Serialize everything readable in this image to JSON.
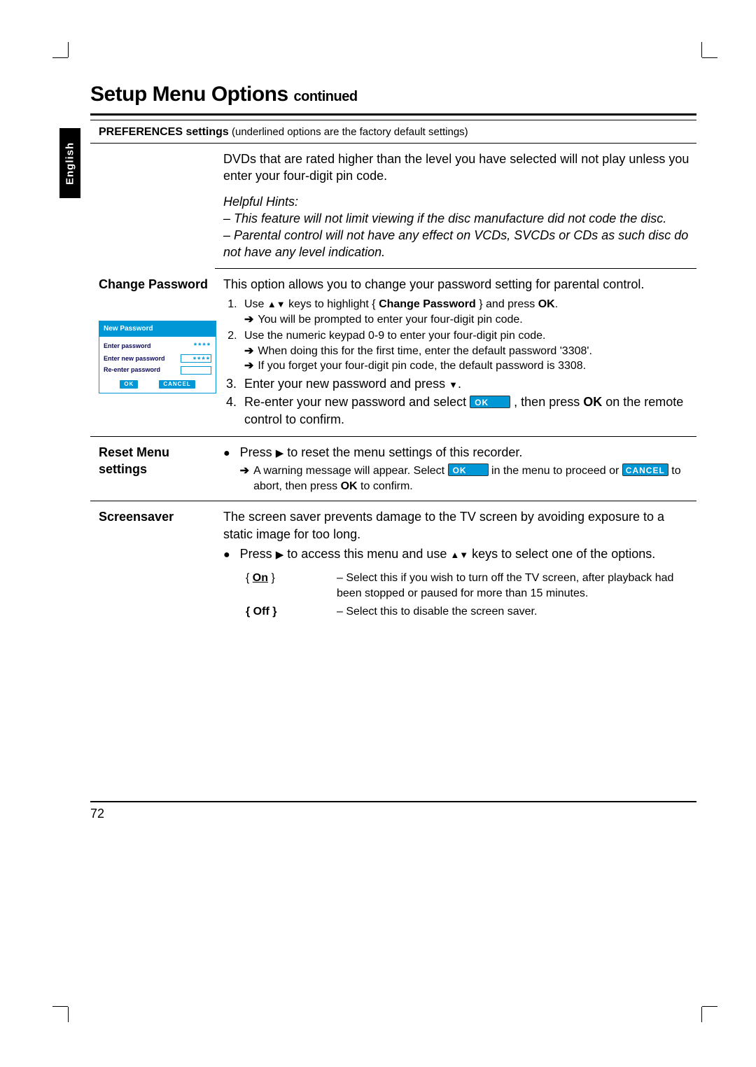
{
  "page": {
    "title_main": "Setup Menu Options",
    "title_cont": "continued",
    "language_tab": "English",
    "page_number": "72"
  },
  "preferences_header": {
    "bold": "PREFERENCES settings",
    "note": " (underlined options are the factory default settings)"
  },
  "rows": {
    "parental_cont": {
      "desc1": "DVDs that are rated higher than the level you have selected will not play unless you enter your four-digit pin code.",
      "hints_label": "Helpful Hints:",
      "hint1": "– This feature will not limit viewing if the disc manufacture did not code the disc.",
      "hint2": "– Parental control will not have any effect on VCDs, SVCDs or CDs as such disc do not have any level indication."
    },
    "change_password": {
      "label": "Change Password",
      "dialog": {
        "title": "New Password",
        "r1": "Enter password",
        "r2": "Enter new password",
        "r3": "Re-enter password",
        "ok": "OK",
        "cancel": "CANCEL"
      },
      "desc": "This option allows you to change your password setting for parental control.",
      "step1_a": "Use ",
      "step1_b": " keys to highlight { ",
      "step1_opt": "Change Password",
      "step1_c": " } and press ",
      "step1_ok": "OK",
      "step1_d": ".",
      "step1_sub": " You will be prompted to enter your four-digit pin code.",
      "step2": "Use the numeric keypad 0-9 to enter your four-digit pin code.",
      "step2_sub": " When doing this for the first time, enter the default password '3308'.",
      "step2_sub2": " If you forget your four-digit pin code, the default password is 3308.",
      "step3_a": "Enter your new password and press ",
      "step3_b": ".",
      "step4_a": "Re-enter your new password and select  ",
      "step4_btn": "OK",
      "step4_b": "  , then press ",
      "step4_ok": "OK",
      "step4_c": " on the remote control to confirm."
    },
    "reset_menu": {
      "label": "Reset Menu settings",
      "line1_a": "Press ",
      "line1_b": " to reset the menu settings of this recorder.",
      "sub_a": " A warning message will appear. Select ",
      "sub_btn_ok": "OK",
      "sub_b": " in the menu to proceed or  ",
      "sub_btn_cancel": "CANCEL",
      "sub_c": "  to abort, then press ",
      "sub_ok": "OK",
      "sub_d": " to confirm."
    },
    "screensaver": {
      "label": "Screensaver",
      "desc": "The screen saver prevents damage to the TV screen by avoiding exposure to a static image for too long.",
      "bullet_a": "Press ",
      "bullet_b": " to access this menu and use ",
      "bullet_c": " keys to select one of the options.",
      "opt_on_label": "{ On }",
      "opt_on_label_inner": "On",
      "opt_on_desc": "– Select this if you wish to turn off the TV screen, after playback had been stopped or paused for more than 15 minutes.",
      "opt_off_label": "{ Off }",
      "opt_off_desc": "– Select this to disable the screen saver."
    }
  }
}
